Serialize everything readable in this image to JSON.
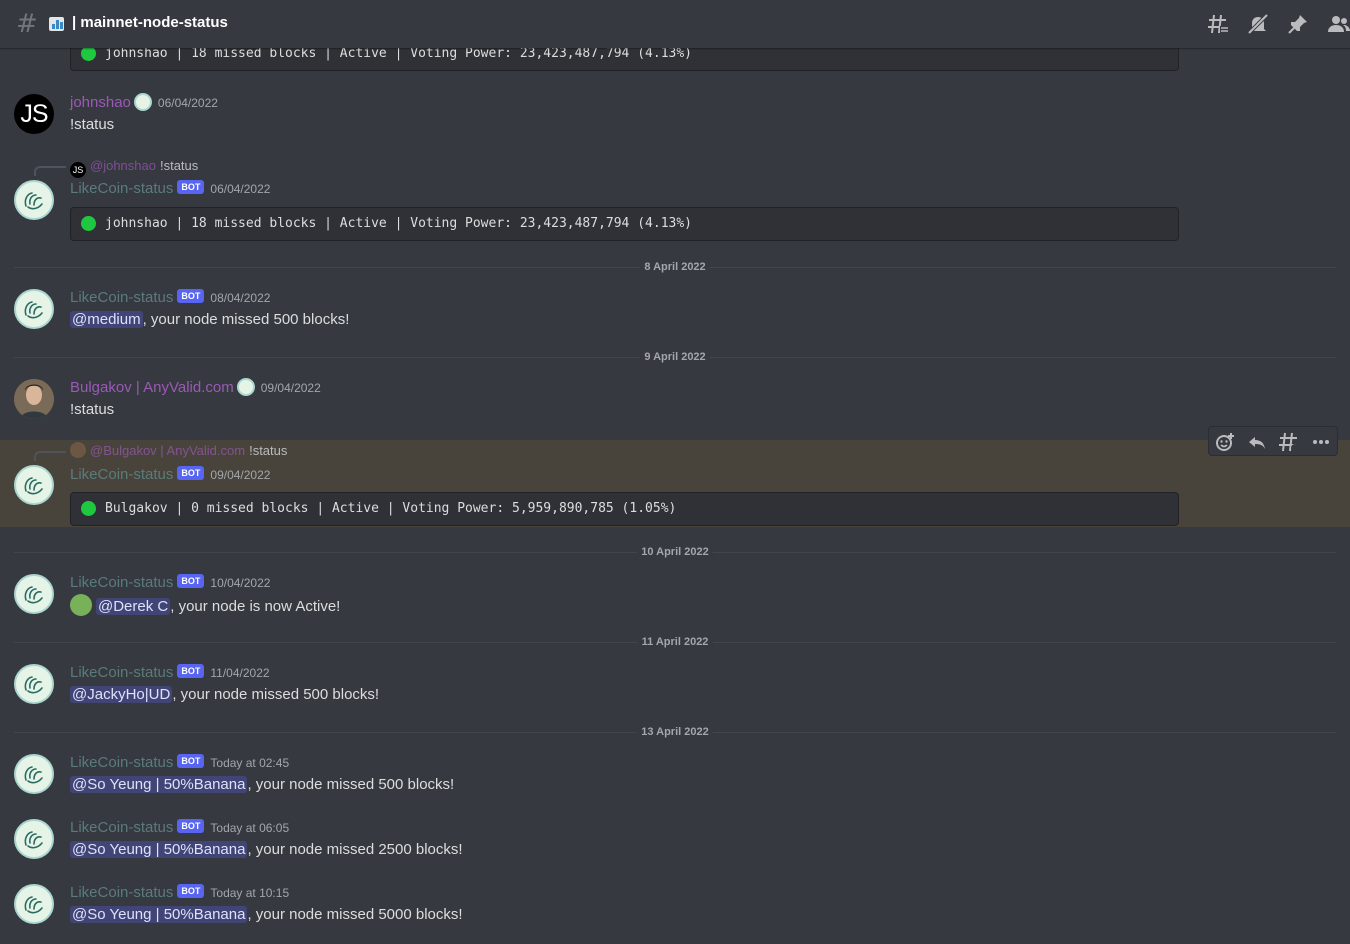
{
  "header": {
    "hash_glyph": "#",
    "channel_name": "| mainnet-node-status",
    "icons": [
      "threads-icon",
      "mute-notifications-icon",
      "pinned-messages-icon",
      "member-list-icon"
    ]
  },
  "message_tools": [
    "add-reaction-icon",
    "reply-icon",
    "create-thread-icon",
    "more-icon"
  ],
  "bot_tag": "BOT",
  "messages": [
    {
      "code": "johnshao | 18 missed blocks | Active | Voting Power: 23,423,487,794 (4.13%)"
    },
    {
      "author": "johnshao",
      "avatar_initials": "JS",
      "timestamp": "06/04/2022",
      "text": "!status"
    },
    {
      "reply_initials": "JS",
      "reply_author": "@johnshao",
      "reply_text": "!status",
      "author": "LikeCoin-status",
      "timestamp": "06/04/2022",
      "code": "johnshao | 18 missed blocks | Active | Voting Power: 23,423,487,794 (4.13%)"
    },
    {
      "divider": "8 April 2022",
      "author": "LikeCoin-status",
      "timestamp": "08/04/2022",
      "mention": "@medium",
      "text": ", your node missed 500 blocks!"
    },
    {
      "divider": "9 April 2022",
      "author": "Bulgakov | AnyValid.com",
      "timestamp": "09/04/2022",
      "text": "!status"
    },
    {
      "reply_author": "@Bulgakov | AnyValid.com",
      "reply_text": "!status",
      "author": "LikeCoin-status",
      "timestamp": "09/04/2022",
      "code": "Bulgakov | 0 missed blocks | Active | Voting Power: 5,959,890,785 (1.05%)"
    },
    {
      "divider": "10 April 2022",
      "author": "LikeCoin-status",
      "timestamp": "10/04/2022",
      "mention": "@Derek C",
      "text": ", your node is now Active!"
    },
    {
      "divider": "11 April 2022",
      "author": "LikeCoin-status",
      "timestamp": "11/04/2022",
      "mention": "@JackyHo|UD",
      "text": ", your node missed 500 blocks!"
    },
    {
      "divider": "13 April 2022",
      "author": "LikeCoin-status",
      "timestamp": "Today at 02:45",
      "mention": "@So Yeung | 50%Banana",
      "text": ", your node missed 500 blocks!"
    },
    {
      "author": "LikeCoin-status",
      "timestamp": "Today at 06:05",
      "mention": "@So Yeung | 50%Banana",
      "text": ", your node missed 2500 blocks!"
    },
    {
      "author": "LikeCoin-status",
      "timestamp": "Today at 10:15",
      "mention": "@So Yeung | 50%Banana",
      "text": ", your node missed 5000 blocks!"
    }
  ],
  "colors": {
    "background": "#36393f",
    "code_block": "#2f3136",
    "mention_bg": "#5865f2",
    "user_name": "#9b59b6",
    "bot_name": "#5a7b7b",
    "status_green": "#1ec940"
  }
}
